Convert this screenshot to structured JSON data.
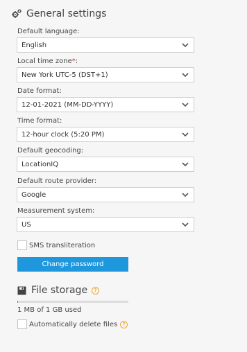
{
  "general": {
    "title": "General settings",
    "icon": "gears-icon"
  },
  "fields": [
    {
      "label": "Default language:",
      "required": "",
      "value": "English"
    },
    {
      "label": "Local time zone",
      "required": "*",
      "label_suffix": ":",
      "value": "New York UTC-5 (DST+1)"
    },
    {
      "label": "Date format:",
      "required": "",
      "value": "12-01-2021 (MM-DD-YYYY)"
    },
    {
      "label": "Time format:",
      "required": "",
      "value": "12-hour clock (5:20 PM)"
    },
    {
      "label": "Default geocoding:",
      "required": "",
      "value": "LocationIQ"
    },
    {
      "label": "Default route provider:",
      "required": "",
      "value": "Google"
    },
    {
      "label": "Measurement system:",
      "required": "",
      "value": "US"
    }
  ],
  "sms_transliteration": {
    "label": "SMS transliteration",
    "checked": false
  },
  "change_password_label": "Change password",
  "file_storage": {
    "title": "File storage",
    "icon": "floppy-disk-icon",
    "usage_text": "1 MB of 1 GB used",
    "usage_fraction": 0.001,
    "auto_delete": {
      "label": "Automatically delete files",
      "checked": false
    }
  },
  "colors": {
    "accent": "#1e97dd",
    "help": "#f2a52b",
    "required": "#e0302a"
  }
}
